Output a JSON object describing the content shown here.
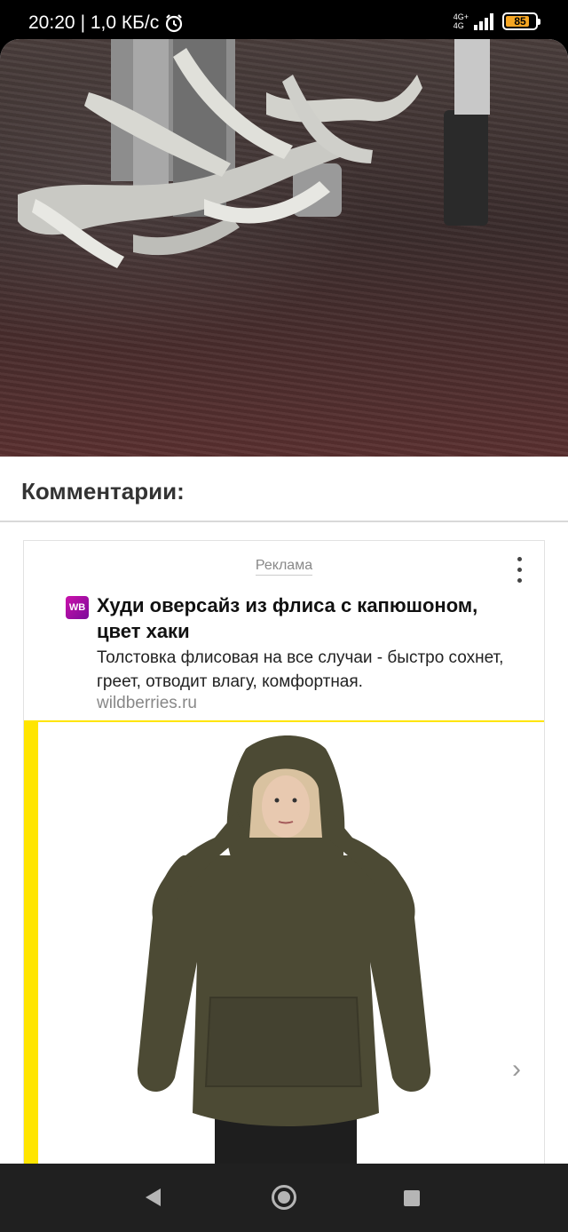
{
  "status_bar": {
    "time": "20:20",
    "speed": "| 1,0 КБ/с",
    "network_top": "4G+",
    "network_bottom": "4G",
    "battery": "85",
    "battery_color": "#f5a623"
  },
  "article": {
    "image_icon": "photo-metal-sculpture",
    "comments_title": "Комментарии:"
  },
  "ad": {
    "label": "Реклама",
    "logo_text": "WB",
    "logo_colors": [
      "#cb11ab",
      "#7b0b9a"
    ],
    "title": "Худи оверсайз из флиса с капюшоном, цвет хаки",
    "description": "Толстовка флисовая на все случаи - быстро сохнет, греет, отводит влагу, комфортная.",
    "domain": "wildberries.ru",
    "accent_color": "#ffe500",
    "image_icon": "photo-khaki-hoodie",
    "next_icon": "chevron-right-icon"
  },
  "nav": {
    "back_icon": "back-triangle-icon",
    "home_icon": "home-circle-icon",
    "recents_icon": "recents-square-icon"
  }
}
